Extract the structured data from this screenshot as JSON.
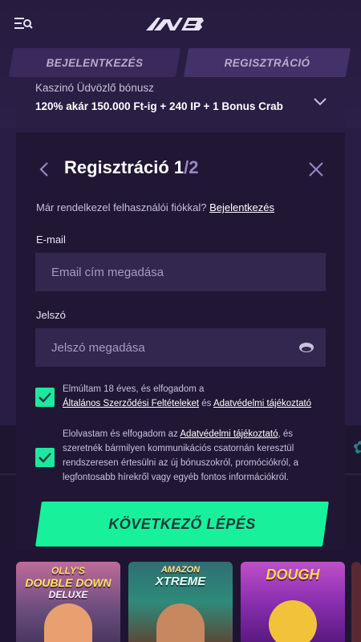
{
  "header": {
    "menu_icon": "menu-search-icon",
    "logo": "brand-logo"
  },
  "tabs": [
    {
      "label": "BEJELENTKEZÉS"
    },
    {
      "label": "REGISZTRÁCIÓ"
    }
  ],
  "bonus": {
    "label": "Kaszinó Üdvözlő bónusz",
    "value": "120% akár 150.000 Ft-ig + 240 IP + 1 Bonus Crab"
  },
  "modal": {
    "title": "Regisztráció 1",
    "step": "/2",
    "have_account": "Már rendelkezel felhasználói fiókkal?",
    "login_link": "Bejelentkezés",
    "email_label": "E-mail",
    "email_placeholder": "Email cím megadása",
    "password_label": "Jelszó",
    "password_placeholder": "Jelszó megadása",
    "terms_text_1": "Elmúltam 18 éves, és elfogadom a",
    "terms_link_1": "Általános Szerződési Feltételeket",
    "terms_and": "és",
    "terms_link_2": "Adatvédelmi tájékoztató",
    "marketing_text_1": "Elolvastam és elfogadom az",
    "marketing_link": "Adatvédelmi tájékoztató",
    "marketing_text_2": ", és szeretnék bármilyen kommunikációs csatornán keresztül rendszeresen értesülni az új bónuszokról, promóciókról, a legfontosabb hírekről vagy egyéb fontos információkról.",
    "next_button": "KÖVETKEZŐ LÉPÉS"
  },
  "games": [
    {
      "line1": "OLLY'S",
      "line2": "DOUBLE DOWN",
      "line3": "DELUXE"
    },
    {
      "line1": "AMAZON",
      "line2": "XTREME"
    },
    {
      "line1": "DOUGH"
    }
  ],
  "colors": {
    "accent": "#18f09c",
    "modal_bg": "#211735",
    "input_bg": "#33264f"
  }
}
